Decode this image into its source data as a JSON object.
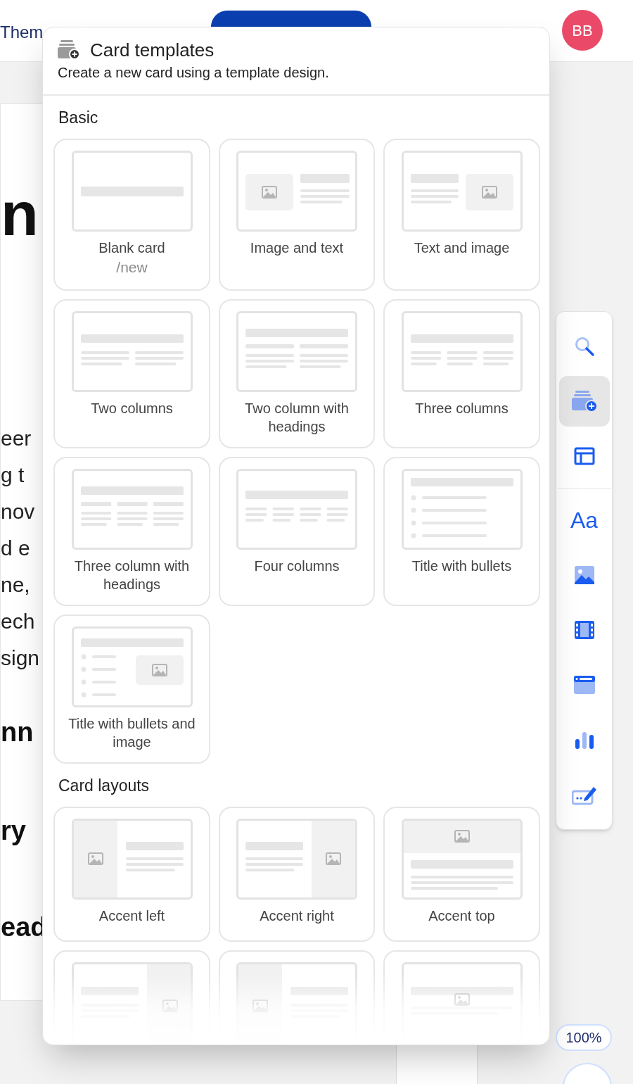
{
  "top_bar": {
    "theme_label": "Them",
    "avatar": "BB"
  },
  "document": {
    "heading": "n",
    "paragraph_lines": [
      "eer",
      "g t",
      "nov",
      "d e",
      "ne,",
      "ech",
      "sign"
    ],
    "subheadings": [
      "nn",
      "ry",
      "ead"
    ]
  },
  "popup": {
    "title": "Card templates",
    "subtitle": "Create a new card using a template design.",
    "sections": [
      {
        "title": "Basic",
        "templates": [
          {
            "kind": "blank",
            "label": "Blank card",
            "shortcut": "/new"
          },
          {
            "kind": "image_text",
            "label": "Image and text"
          },
          {
            "kind": "text_image",
            "label": "Text and image"
          },
          {
            "kind": "two_col",
            "label": "Two columns"
          },
          {
            "kind": "two_col_head",
            "label": "Two column with headings"
          },
          {
            "kind": "three_col",
            "label": "Three columns"
          },
          {
            "kind": "three_col_head",
            "label": "Three column with headings"
          },
          {
            "kind": "four_col",
            "label": "Four columns"
          },
          {
            "kind": "title_bullets",
            "label": "Title with bullets"
          },
          {
            "kind": "title_bullets_image",
            "label": "Title with bullets and image"
          }
        ]
      },
      {
        "title": "Card layouts",
        "templates": [
          {
            "kind": "accent_left",
            "label": "Accent left"
          },
          {
            "kind": "accent_right",
            "label": "Accent right"
          },
          {
            "kind": "accent_top",
            "label": "Accent top"
          },
          {
            "kind": "accent_right_fit"
          },
          {
            "kind": "accent_left_fit"
          },
          {
            "kind": "accent_top_fit"
          }
        ]
      }
    ]
  },
  "toolbar": {
    "groups": [
      [
        {
          "kind": "search",
          "selected": false
        },
        {
          "kind": "card_templates",
          "selected": true
        },
        {
          "kind": "layout",
          "selected": false
        }
      ],
      [
        {
          "kind": "text",
          "label": "Aa",
          "selected": false
        },
        {
          "kind": "image",
          "selected": false
        },
        {
          "kind": "video",
          "selected": false
        },
        {
          "kind": "embed",
          "selected": false
        },
        {
          "kind": "chart",
          "selected": false
        },
        {
          "kind": "form",
          "selected": false
        }
      ]
    ]
  },
  "zoom": "100%"
}
